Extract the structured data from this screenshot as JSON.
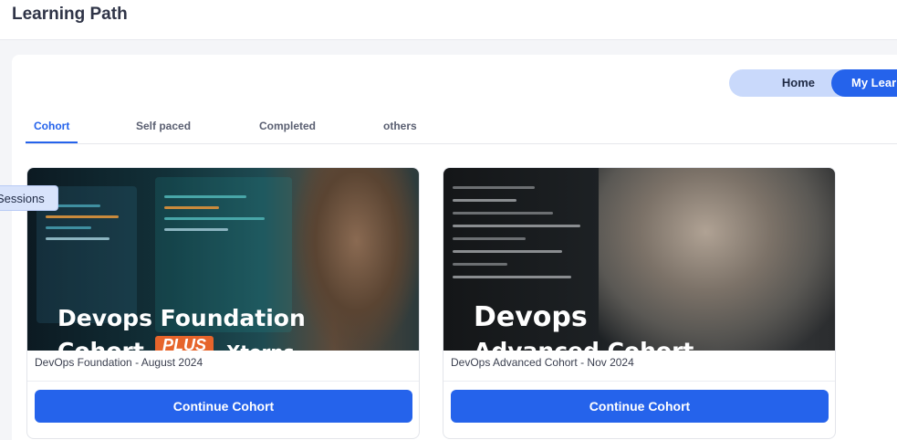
{
  "header": {
    "title": "Learning Path"
  },
  "toggle": {
    "home_label": "Home",
    "my_label": "My Lear"
  },
  "tabs": [
    {
      "label": "Cohort",
      "active": true
    },
    {
      "label": "Self paced",
      "active": false
    },
    {
      "label": "Completed",
      "active": false
    },
    {
      "label": "others",
      "active": false
    }
  ],
  "side_tab": {
    "label": "Sessions"
  },
  "cards": [
    {
      "image_title_line1": "Devops Foundation",
      "image_title_line2": "Cohort",
      "image_badge": "PLUS",
      "image_title_suffix": "Xterns",
      "subtitle": "DevOps Foundation - August 2024",
      "button": "Continue Cohort"
    },
    {
      "image_title_line1": "Devops",
      "image_title_line2": "Advanced Cohort",
      "subtitle": "DevOps Advanced Cohort - Nov 2024",
      "button": "Continue Cohort"
    }
  ],
  "colors": {
    "primary": "#2563eb",
    "toggle_bg": "#c9d9fb",
    "badge": "#e6642b"
  }
}
